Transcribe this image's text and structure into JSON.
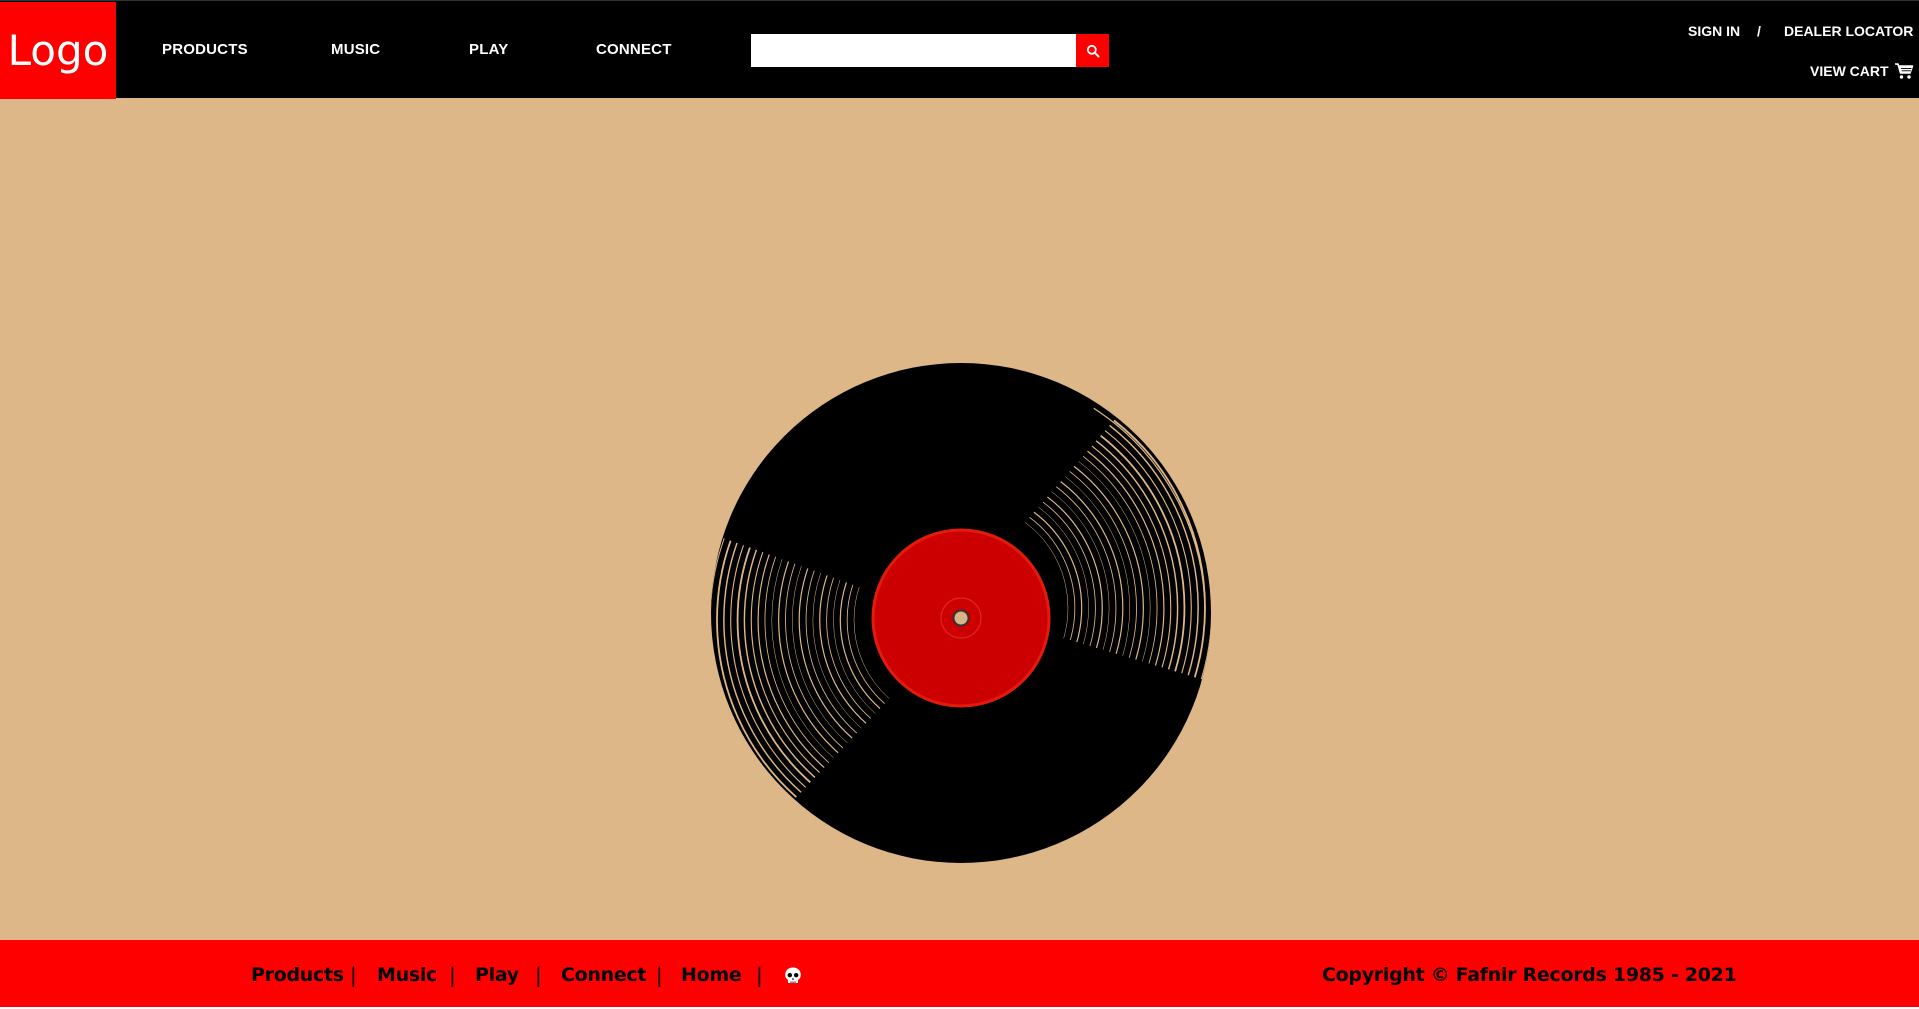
{
  "header": {
    "logo_text": "Logo",
    "nav": [
      {
        "label": "PRODUCTS"
      },
      {
        "label": "MUSIC"
      },
      {
        "label": "PLAY"
      },
      {
        "label": "CONNECT"
      }
    ],
    "search": {
      "value": "",
      "placeholder": "",
      "icon": "search-icon"
    },
    "sign_in": "SIGN IN",
    "separator": "/",
    "dealer_locator": "DEALER LOCATOR",
    "view_cart": "VIEW CART",
    "cart_icon": "cart-icon"
  },
  "main": {
    "illustration": "vinyl-record",
    "colors": {
      "background": "#ddb787",
      "label": "#cc0000",
      "vinyl": "#000000"
    }
  },
  "footer": {
    "links": [
      {
        "label": "Products"
      },
      {
        "label": "Music"
      },
      {
        "label": "Play"
      },
      {
        "label": "Connect"
      },
      {
        "label": "Home"
      }
    ],
    "separator": "|",
    "skull_icon": "skull-icon",
    "copyright": "Copyright © Fafnir Records 1985 - 2021"
  },
  "colors": {
    "accent": "#ff0000",
    "header_bg": "#000000",
    "footer_bg": "#ff0000"
  }
}
